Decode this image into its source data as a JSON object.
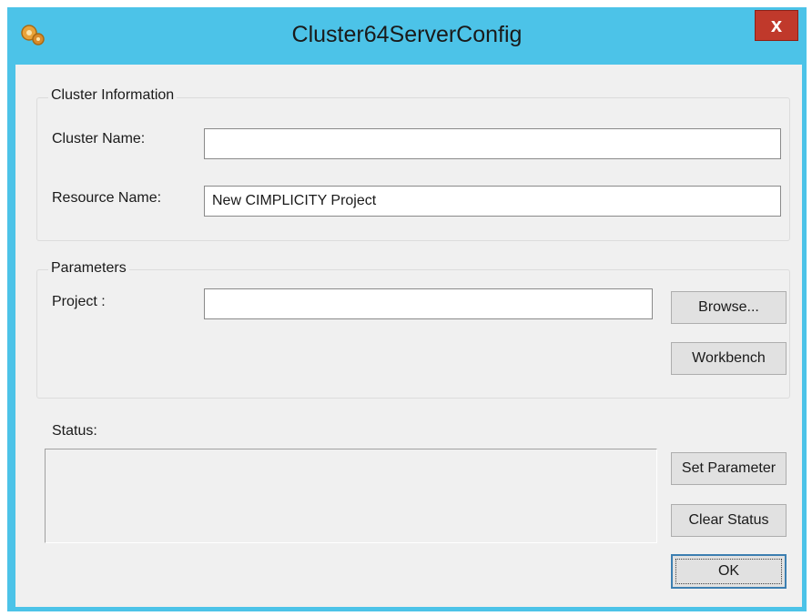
{
  "window": {
    "title": "Cluster64ServerConfig",
    "close_label": "x"
  },
  "cluster_info": {
    "group_label": "Cluster Information",
    "cluster_name_label": "Cluster Name:",
    "cluster_name_value": "",
    "resource_name_label": "Resource Name:",
    "resource_name_value": "New CIMPLICITY Project"
  },
  "parameters": {
    "group_label": "Parameters",
    "project_label": "Project :",
    "project_value": "",
    "browse_label": "Browse...",
    "workbench_label": "Workbench"
  },
  "status": {
    "label": "Status:",
    "text": "",
    "set_parameter_label": "Set Parameter",
    "clear_status_label": "Clear Status",
    "ok_label": "OK"
  },
  "colors": {
    "title_bar": "#4cc3e8",
    "close_button": "#c0392b",
    "client_bg": "#f0f0f0"
  },
  "icons": {
    "app": "gear-icon",
    "close": "close-icon"
  }
}
